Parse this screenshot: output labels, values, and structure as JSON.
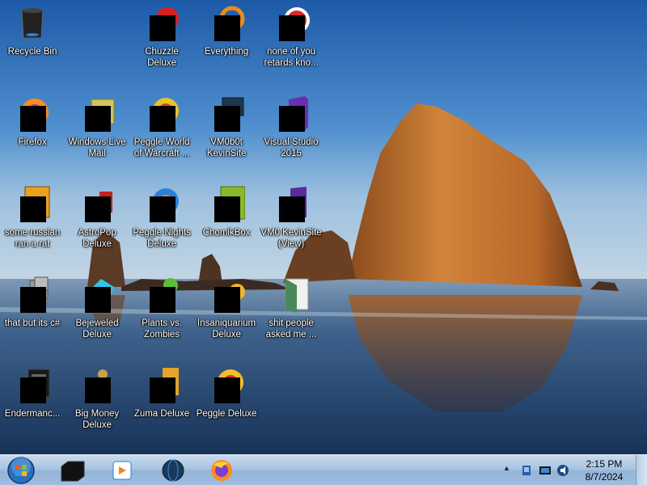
{
  "desktop": {
    "icons": [
      {
        "label": "Recycle Bin",
        "icon": "recycle-bin-icon",
        "redacted": false
      },
      {
        "label": "Chuzzle Deluxe",
        "icon": "chuzzle-icon",
        "redacted": true
      },
      {
        "label": "Everything",
        "icon": "everything-search-icon",
        "redacted": true
      },
      {
        "label": "none of you retards kno...",
        "icon": "game-icon",
        "redacted": true
      },
      {
        "label": "Firefox",
        "icon": "firefox-icon",
        "redacted": true
      },
      {
        "label": "Windows Live Mail",
        "icon": "mail-icon",
        "redacted": true
      },
      {
        "label": "Peggle World of Warcraft ...",
        "icon": "peggle-icon",
        "redacted": true
      },
      {
        "label": "VM0b0t KevinSite",
        "icon": "vm-monitor-icon",
        "redacted": true
      },
      {
        "label": "Visual Studio 2015",
        "icon": "visual-studio-icon",
        "redacted": true
      },
      {
        "label": "some russian ran a rat",
        "icon": "document-icon",
        "redacted": true
      },
      {
        "label": "AstroPop Deluxe",
        "icon": "astropop-icon",
        "redacted": true
      },
      {
        "label": "Peggle Nights Deluxe",
        "icon": "peggle-nights-icon",
        "redacted": true
      },
      {
        "label": "ChomikBox",
        "icon": "chomikbox-icon",
        "redacted": true
      },
      {
        "label": "VM0 KevinSite (View)",
        "icon": "visual-studio-icon",
        "redacted": true
      },
      {
        "label": "that but its c#",
        "icon": "folder-stack-icon",
        "redacted": true
      },
      {
        "label": "Bejeweled Deluxe",
        "icon": "bejeweled-icon",
        "redacted": true
      },
      {
        "label": "Plants vs. Zombies",
        "icon": "plants-vs-zombies-icon",
        "redacted": true
      },
      {
        "label": "Insaniquarium Deluxe",
        "icon": "insaniquarium-icon",
        "redacted": true
      },
      {
        "label": "shit people asked me ...",
        "icon": "video-file-icon",
        "redacted": false
      },
      {
        "label": "Endermanc...",
        "icon": "terminal-icon",
        "redacted": true
      },
      {
        "label": "Big Money Deluxe",
        "icon": "money-bag-icon",
        "redacted": true
      },
      {
        "label": "Zuma Deluxe",
        "icon": "zuma-icon",
        "redacted": true
      },
      {
        "label": "Peggle Deluxe",
        "icon": "peggle-icon",
        "redacted": true
      }
    ]
  },
  "taskbar": {
    "start_icon": "windows-start-orb-icon",
    "pinned": [
      {
        "icon": "terminal-icon"
      },
      {
        "icon": "media-player-icon"
      },
      {
        "icon": "globe-icon"
      },
      {
        "icon": "firefox-icon"
      }
    ],
    "tray": {
      "overflow": "▲",
      "icons": [
        "network-icon",
        "monitor-icon",
        "volume-icon"
      ],
      "time": "2:15 PM",
      "date": "8/7/2024"
    }
  },
  "colors": {
    "taskbar": "#a9c4e2",
    "sky": "#3a7cc4",
    "rock": "#c9782c"
  }
}
